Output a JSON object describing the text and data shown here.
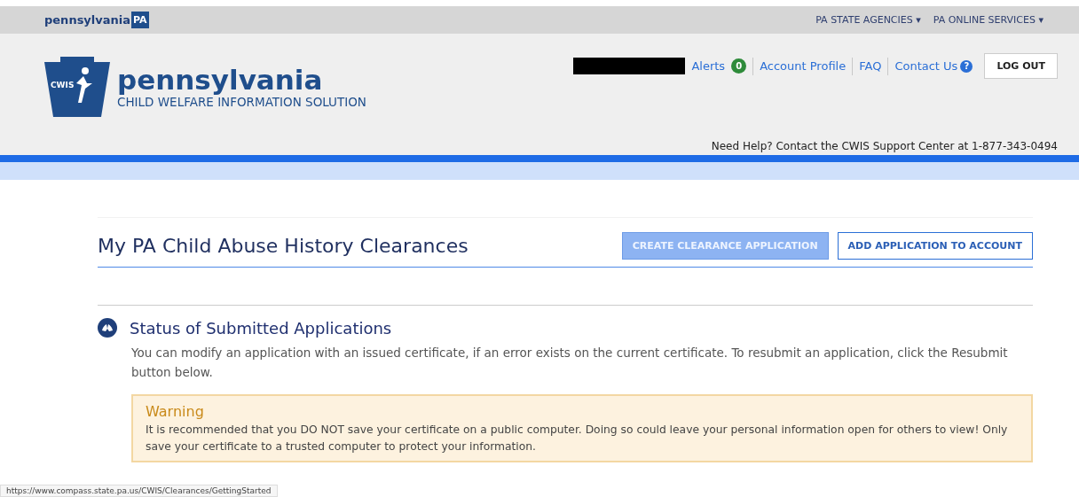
{
  "top_bar": {
    "brand": "pennsylvania",
    "brand_badge": "PA",
    "menus": [
      {
        "label": "PA STATE AGENCIES",
        "caret": "▾"
      },
      {
        "label": "PA ONLINE SERVICES",
        "caret": "▾"
      }
    ]
  },
  "header": {
    "logo_badge": "CWIS",
    "title": "pennsylvania",
    "subtitle": "CHILD WELFARE INFORMATION SOLUTION",
    "links": [
      {
        "kind": "alerts",
        "label": "Alerts",
        "count": "0"
      },
      {
        "kind": "link",
        "label": "Account Profile"
      },
      {
        "kind": "link",
        "label": "FAQ"
      },
      {
        "kind": "help",
        "label": "Contact Us",
        "icon": "?"
      }
    ],
    "logout": "LOG OUT",
    "help_text": "Need Help? Contact the CWIS Support Center at 1-877-343-0494"
  },
  "page": {
    "title": "My PA Child Abuse History Clearances",
    "buttons": [
      {
        "label": "CREATE CLEARANCE APPLICATION",
        "disabled": true
      },
      {
        "label": "ADD APPLICATION TO ACCOUNT",
        "disabled": false
      }
    ]
  },
  "status_section": {
    "heading": "Status of Submitted Applications",
    "text": "You can modify an application with an issued certificate, if an error exists on the current certificate. To resubmit an application, click the Resubmit button below."
  },
  "warning": {
    "title": "Warning",
    "text": "It is recommended that you DO NOT save your certificate on a public computer. Doing so could leave your personal information open for others to view! Only save your certificate to a trusted computer to protect your information."
  },
  "status_url": "https://www.compass.state.pa.us/CWIS/Clearances/GettingStarted"
}
